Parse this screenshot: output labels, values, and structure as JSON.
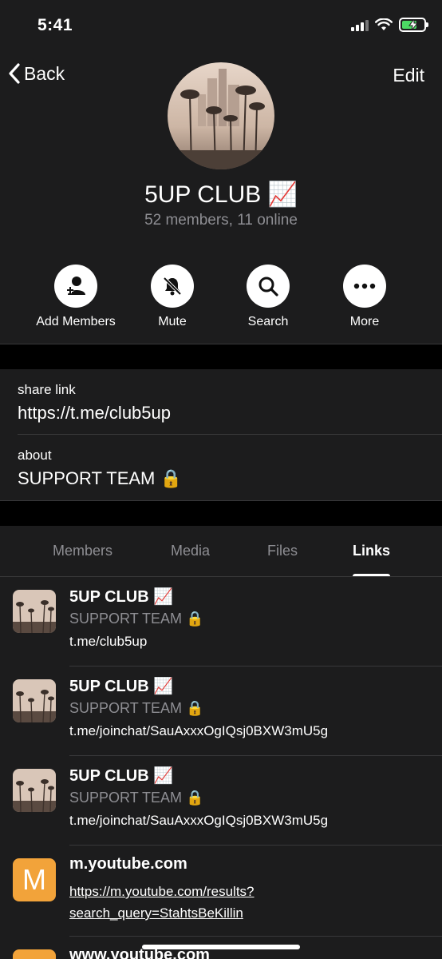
{
  "status_bar": {
    "time": "5:41"
  },
  "nav": {
    "back_label": "Back",
    "edit_label": "Edit"
  },
  "group": {
    "name": "5UP CLUB 📈",
    "subtitle": "52 members, 11 online"
  },
  "actions": [
    {
      "label": "Add Members",
      "icon": "add-member-icon"
    },
    {
      "label": "Mute",
      "icon": "bell-muted-icon"
    },
    {
      "label": "Search",
      "icon": "search-icon"
    },
    {
      "label": "More",
      "icon": "more-icon"
    }
  ],
  "info": {
    "share_link_label": "share link",
    "share_link_value": "https://t.me/club5up",
    "about_label": "about",
    "about_value": "SUPPORT TEAM 🔒"
  },
  "tabs": [
    {
      "label": "Members",
      "active": false
    },
    {
      "label": "Media",
      "active": false
    },
    {
      "label": "Files",
      "active": false
    },
    {
      "label": "Links",
      "active": true
    }
  ],
  "links": [
    {
      "title": "5UP CLUB 📈",
      "description": "SUPPORT TEAM 🔒",
      "url": "t.me/club5up"
    },
    {
      "title": "5UP CLUB 📈",
      "description": "SUPPORT TEAM 🔒",
      "url": "t.me/joinchat/SauAxxxOgIQsj0BXW3mU5g"
    },
    {
      "title": "5UP CLUB 📈",
      "description": "SUPPORT TEAM 🔒",
      "url": "t.me/joinchat/SauAxxxOgIQsj0BXW3mU5g"
    },
    {
      "thumb_letter": "M",
      "title": "m.youtube.com",
      "url_line1": "https://m.youtube.com/results?",
      "url_line2": "search_query=StahtsBeKillin"
    },
    {
      "title": "www.youtube.com"
    }
  ],
  "colors": {
    "background": "#1c1c1d",
    "secondary_text": "#8e8e93",
    "battery_green": "#4cd964",
    "link_thumb_orange": "#f2a33a"
  }
}
